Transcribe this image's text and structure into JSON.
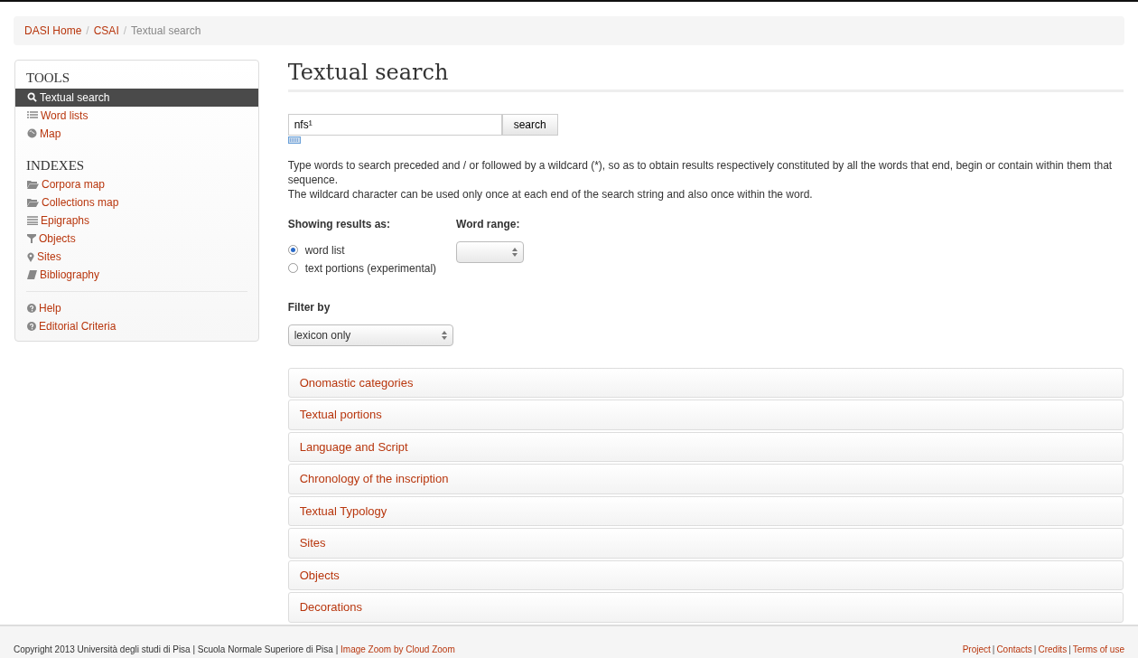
{
  "breadcrumb": [
    {
      "label": "DASI Home",
      "link": true
    },
    {
      "label": "CSAI",
      "link": true
    },
    {
      "label": "Textual search",
      "link": false
    }
  ],
  "breadcrumb_separator": "/",
  "sidebar": {
    "sections": [
      {
        "title": "TOOLS",
        "items": [
          {
            "label": "Textual search",
            "selected": true
          },
          {
            "label": "Word lists",
            "selected": false
          },
          {
            "label": "Map",
            "selected": false
          }
        ]
      },
      {
        "title": "INDEXES",
        "items": [
          {
            "label": "Corpora map",
            "selected": false
          },
          {
            "label": "Collections map",
            "selected": false
          },
          {
            "label": "Epigraphs",
            "selected": false
          },
          {
            "label": "Objects",
            "selected": false
          },
          {
            "label": "Sites",
            "selected": false
          },
          {
            "label": "Bibliography",
            "selected": false
          }
        ]
      },
      {
        "items": [
          {
            "label": "Help",
            "selected": false
          },
          {
            "label": "Editorial Criteria",
            "selected": false
          }
        ]
      }
    ]
  },
  "page_title": "Textual search",
  "search": {
    "value": "nfs¹",
    "button": "search"
  },
  "help_text": [
    "Type words to search preceded and / or followed by a wildcard (*), so as to obtain results respectively constituted by all the words that end, begin or contain within them that sequence.",
    "The wildcard character can be used only once at each end of the search string and also once within the word."
  ],
  "showing_results": {
    "label": "Showing results as:",
    "options": [
      {
        "label": "word list",
        "selected": true
      },
      {
        "label": "text portions (experimental)",
        "selected": false
      }
    ]
  },
  "word_range": {
    "label": "Word range:"
  },
  "filter": {
    "label": "Filter by",
    "value": "lexicon only"
  },
  "accordion": [
    "Onomastic categories",
    "Textual portions",
    "Language and Script",
    "Chronology of the inscription",
    "Textual Typology",
    "Sites",
    "Objects",
    "Decorations"
  ],
  "footer": {
    "text": "Copyright 2013 Università degli studi di Pisa | Scuola Normale Superiore di Pisa |",
    "link": "Image Zoom by Cloud Zoom",
    "links": [
      "Project",
      "Contacts",
      "Credits",
      "Terms of use"
    ],
    "separator": "|"
  }
}
